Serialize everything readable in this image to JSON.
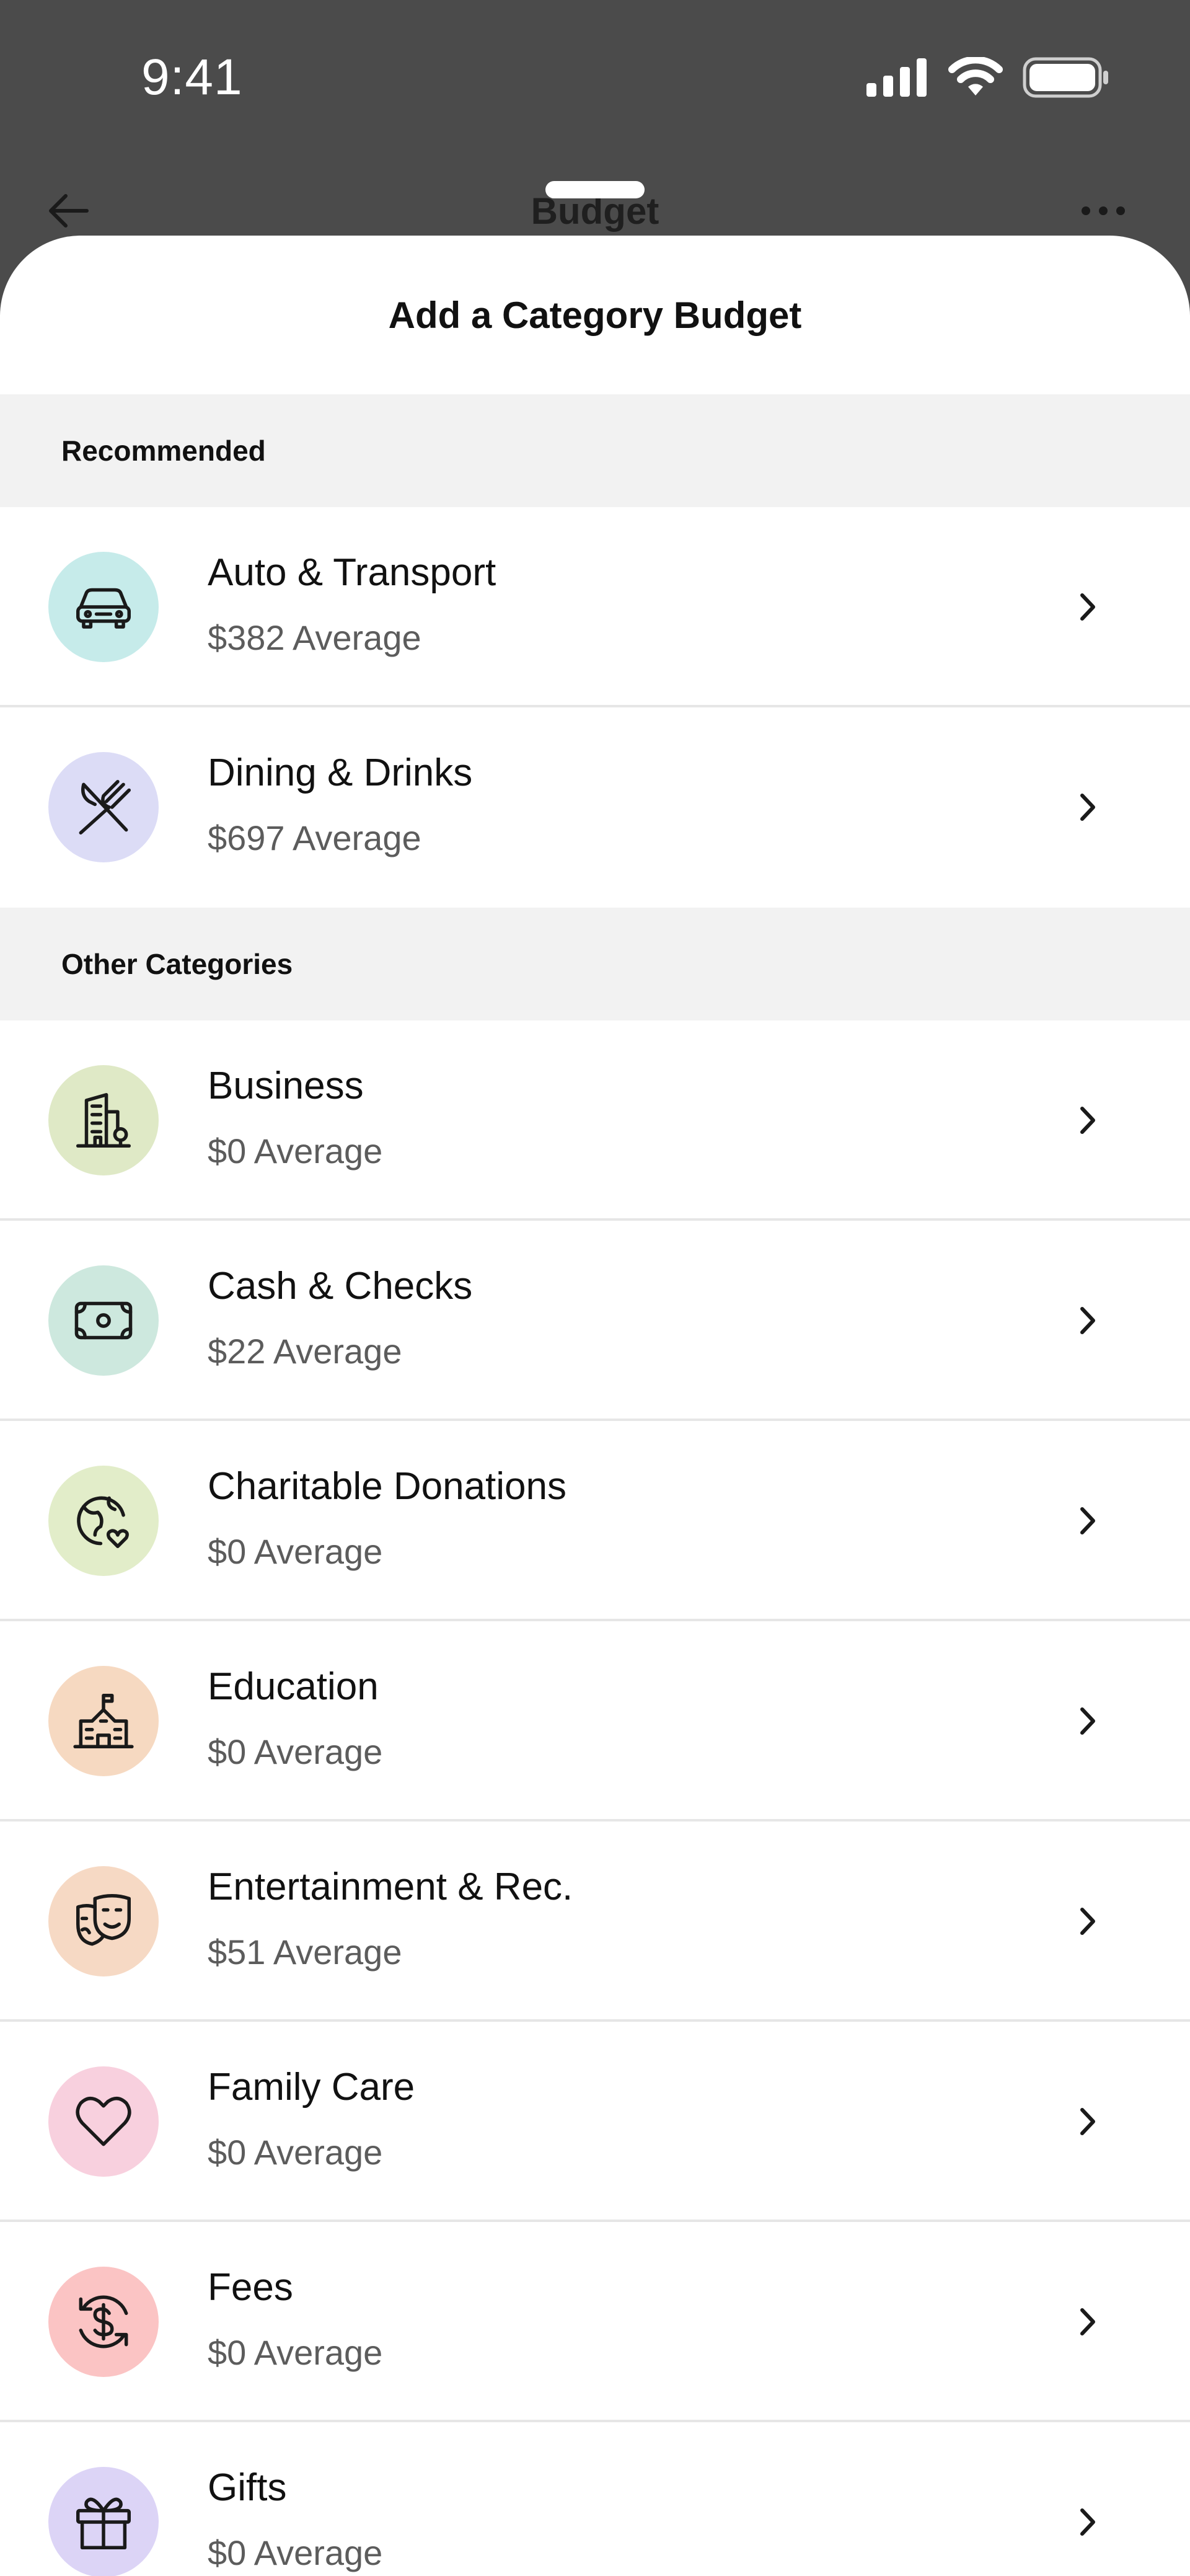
{
  "status_bar": {
    "time": "9:41"
  },
  "behind_header": {
    "title": "Budget"
  },
  "sheet": {
    "title": "Add a Category Budget"
  },
  "sections": [
    {
      "title": "Recommended",
      "items": [
        {
          "name": "Auto & Transport",
          "average": "$382 Average",
          "icon": "car-icon",
          "color": "#c6ebea"
        },
        {
          "name": "Dining & Drinks",
          "average": "$697 Average",
          "icon": "utensils-icon",
          "color": "#dcdcf6"
        }
      ]
    },
    {
      "title": "Other Categories",
      "items": [
        {
          "name": "Business",
          "average": "$0 Average",
          "icon": "building-icon",
          "color": "#dfe9c6"
        },
        {
          "name": "Cash & Checks",
          "average": "$22 Average",
          "icon": "cash-icon",
          "color": "#cde8de"
        },
        {
          "name": "Charitable Donations",
          "average": "$0 Average",
          "icon": "globe-heart-icon",
          "color": "#e2edc9"
        },
        {
          "name": "Education",
          "average": "$0 Average",
          "icon": "school-icon",
          "color": "#f6d9c1"
        },
        {
          "name": "Entertainment & Rec.",
          "average": "$51 Average",
          "icon": "theater-masks-icon",
          "color": "#f6d9c4"
        },
        {
          "name": "Family Care",
          "average": "$0 Average",
          "icon": "heart-icon",
          "color": "#f8d0de"
        },
        {
          "name": "Fees",
          "average": "$0 Average",
          "icon": "fee-dollar-icon",
          "color": "#fbc4c4"
        },
        {
          "name": "Gifts",
          "average": "$0 Average",
          "icon": "gift-icon",
          "color": "#dcd4f6"
        }
      ]
    }
  ]
}
